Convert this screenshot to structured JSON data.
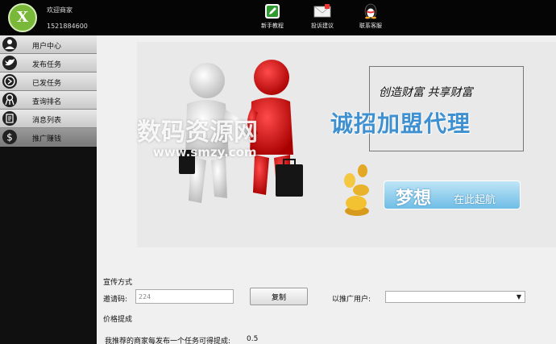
{
  "header": {
    "logo_letter": "X",
    "welcome": "欢迎商家",
    "phone": "1521884600",
    "buttons": [
      {
        "label": "新手教程",
        "icon": "pencil-icon"
      },
      {
        "label": "投诉建议",
        "icon": "envelope-icon"
      },
      {
        "label": "联系客服",
        "icon": "qq-penguin-icon"
      }
    ]
  },
  "sidebar": {
    "items": [
      {
        "label": "用户中心",
        "icon": "user-icon",
        "active": false
      },
      {
        "label": "发布任务",
        "icon": "twitter-bird-icon",
        "active": false
      },
      {
        "label": "已发任务",
        "icon": "arrow-circle-icon",
        "active": false
      },
      {
        "label": "查询排名",
        "icon": "ribbon-icon",
        "active": false
      },
      {
        "label": "消息列表",
        "icon": "document-icon",
        "active": false
      },
      {
        "label": "推广赚钱",
        "icon": "dollar-icon",
        "active": true
      }
    ]
  },
  "banner": {
    "slogan": "创造财富 共享财富",
    "headline": "诚招加盟代理",
    "dream_big": "梦想",
    "dream_small": "在此起航",
    "watermark": "数码资源网",
    "watermark_url": "www.smzy.com"
  },
  "promotion": {
    "section_title": "宣传方式",
    "invite_label": "邀请码:",
    "invite_code": "224",
    "copy_button": "复制",
    "promoted_user_label": "以推广用户:",
    "promoted_user_value": ""
  },
  "pricing": {
    "section_title": "价格提成",
    "rate_label": "我推荐的商家每发布一个任务可得提成:",
    "rate_value": "0.5"
  },
  "colors": {
    "topbar": "#050505",
    "logo_green": "#7ab83a",
    "headline_blue": "#3e90d0",
    "sidebar_active": "#8a8a8a"
  }
}
